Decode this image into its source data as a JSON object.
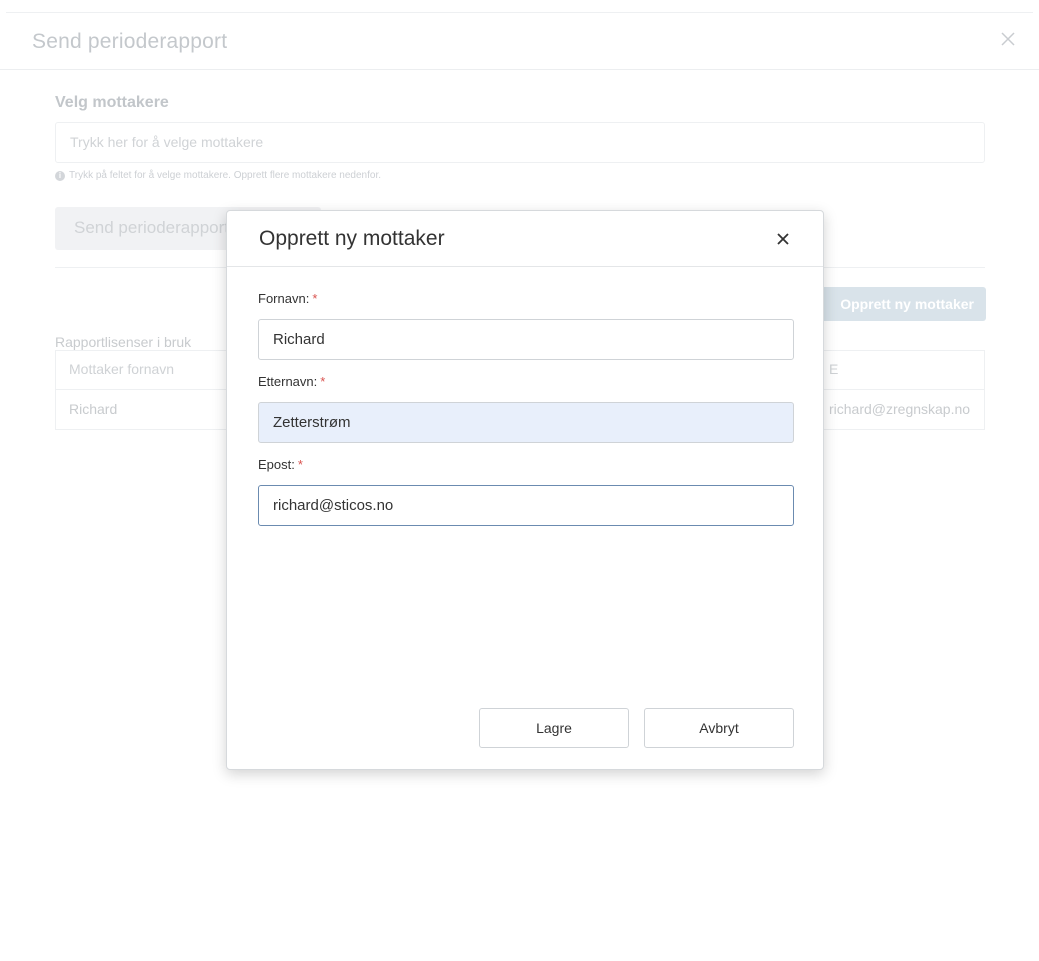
{
  "background": {
    "title": "Send perioderapport",
    "section_title": "Velg mottakere",
    "recipients_placeholder": "Trykk her for å velge mottakere",
    "help_text": "Trykk på feltet for å velge mottakere. Opprett flere mottakere nedenfor.",
    "send_button_label": "Send perioderapport",
    "create_button_label": "Opprett ny mottaker",
    "licenses_label": "Rapportlisenser i bruk",
    "table": {
      "col_firstname": "Mottaker fornavn",
      "col_right": "E",
      "row_firstname": "Richard",
      "row_email": "richard@zregnskap.no"
    }
  },
  "modal": {
    "title": "Opprett ny mottaker",
    "required_marker": "*",
    "fields": {
      "firstname": {
        "label": "Fornavn:",
        "value": "Richard"
      },
      "lastname": {
        "label": "Etternavn:",
        "value": "Zetterstrøm"
      },
      "email": {
        "label": "Epost:",
        "value": "richard@sticos.no"
      }
    },
    "save_label": "Lagre",
    "cancel_label": "Avbryt"
  },
  "colors": {
    "required": "#d9534f",
    "autofill_bg": "#e8effb",
    "focus_border": "#6b8bb0"
  },
  "icons": {
    "modal_close": "close-icon",
    "background_close": "close-icon",
    "help": "info-icon"
  }
}
